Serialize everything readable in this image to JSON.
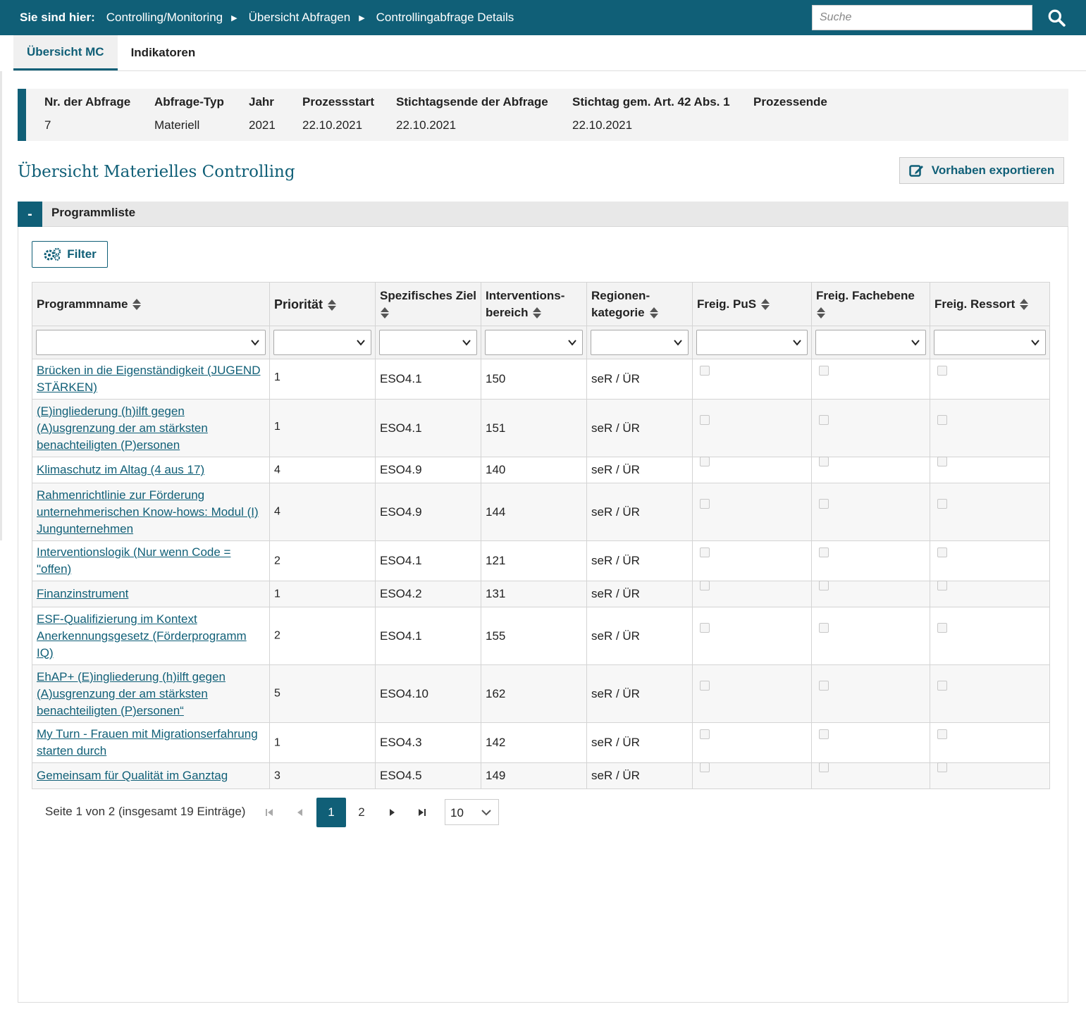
{
  "breadcrumb": {
    "label": "Sie sind hier:",
    "items": [
      "Controlling/Monitoring",
      "Übersicht Abfragen",
      "Controllingabfrage Details"
    ]
  },
  "search": {
    "placeholder": "Suche"
  },
  "tabs": [
    {
      "label": "Übersicht MC",
      "active": true
    },
    {
      "label": "Indikatoren",
      "active": false
    }
  ],
  "info": {
    "columns": [
      {
        "header": "Nr. der Abfrage",
        "value": "7"
      },
      {
        "header": "Abfrage-Typ",
        "value": "Materiell"
      },
      {
        "header": "Jahr",
        "value": "2021"
      },
      {
        "header": "Prozessstart",
        "value": "22.10.2021"
      },
      {
        "header": "Stichtagsende der Abfrage",
        "value": "22.10.2021"
      },
      {
        "header": "Stichtag gem. Art. 42 Abs. 1",
        "value": "22.10.2021"
      },
      {
        "header": "Prozessende",
        "value": ""
      }
    ]
  },
  "section": {
    "title": "Übersicht Materielles Controlling",
    "export_label": "Vorhaben exportieren"
  },
  "accordion": {
    "toggle": "-",
    "title": "Programmliste",
    "filter_label": "Filter"
  },
  "table": {
    "headers": [
      {
        "line1": "Programmname",
        "line2": ""
      },
      {
        "line1": "Priorität",
        "line2": ""
      },
      {
        "line1": "Spezifisches Ziel",
        "line2": ""
      },
      {
        "line1": "Interventions-",
        "line2": "bereich"
      },
      {
        "line1": "Regionen-",
        "line2": "kategorie"
      },
      {
        "line1": "Freig. PuS",
        "line2": ""
      },
      {
        "line1": "Freig. Fachebene",
        "line2": ""
      },
      {
        "line1": "Freig. Ressort",
        "line2": ""
      }
    ],
    "rows": [
      {
        "name": "Brücken in die Eigenständigkeit (JUGEND STÄRKEN)",
        "prio": "1",
        "ziel": "ESO4.1",
        "bereich": "150",
        "region": "seR / ÜR",
        "pus": false,
        "fach": false,
        "ressort": false
      },
      {
        "name": "(E)ingliederung (h)ilft gegen (A)usgrenzung der am stärksten benachteiligten (P)ersonen",
        "prio": "1",
        "ziel": "ESO4.1",
        "bereich": "151",
        "region": "seR / ÜR",
        "pus": false,
        "fach": false,
        "ressort": false
      },
      {
        "name": "Klimaschutz im Altag (4 aus 17)",
        "prio": "4",
        "ziel": "ESO4.9",
        "bereich": "140",
        "region": "seR / ÜR",
        "pus": false,
        "fach": false,
        "ressort": false
      },
      {
        "name": "Rahmenrichtlinie zur Förderung unternehmerischen Know-hows: Modul (I) Jungunternehmen",
        "prio": "4",
        "ziel": "ESO4.9",
        "bereich": "144",
        "region": "seR / ÜR",
        "pus": false,
        "fach": false,
        "ressort": false
      },
      {
        "name": "Interventionslogik (Nur wenn Code = \"offen)",
        "prio": "2",
        "ziel": "ESO4.1",
        "bereich": "121",
        "region": "seR / ÜR",
        "pus": false,
        "fach": false,
        "ressort": false
      },
      {
        "name": "Finanzinstrument",
        "prio": "1",
        "ziel": "ESO4.2",
        "bereich": "131",
        "region": "seR / ÜR",
        "pus": false,
        "fach": false,
        "ressort": false
      },
      {
        "name": "ESF-Qualifizierung im Kontext Anerkennungsgesetz (Förderprogramm IQ)",
        "prio": "2",
        "ziel": "ESO4.1",
        "bereich": "155",
        "region": "seR / ÜR",
        "pus": false,
        "fach": false,
        "ressort": false
      },
      {
        "name": "EhAP+ (E)ingliederung (h)ilft gegen (A)usgrenzung der am stärksten benachteiligten (P)ersonen“",
        "prio": "5",
        "ziel": "ESO4.10",
        "bereich": "162",
        "region": "seR / ÜR",
        "pus": false,
        "fach": false,
        "ressort": false
      },
      {
        "name": "My Turn - Frauen mit Migrationserfahrung starten durch",
        "prio": "1",
        "ziel": "ESO4.3",
        "bereich": "142",
        "region": "seR / ÜR",
        "pus": false,
        "fach": false,
        "ressort": false
      },
      {
        "name": "Gemeinsam für Qualität im Ganztag",
        "prio": "3",
        "ziel": "ESO4.5",
        "bereich": "149",
        "region": "seR / ÜR",
        "pus": false,
        "fach": false,
        "ressort": false
      }
    ]
  },
  "pagination": {
    "info": "Seite 1 von 2 (insgesamt 19 Einträge)",
    "pages": [
      "1",
      "2"
    ],
    "current": "1",
    "page_size": "10"
  },
  "colors": {
    "primary": "#105f77"
  }
}
